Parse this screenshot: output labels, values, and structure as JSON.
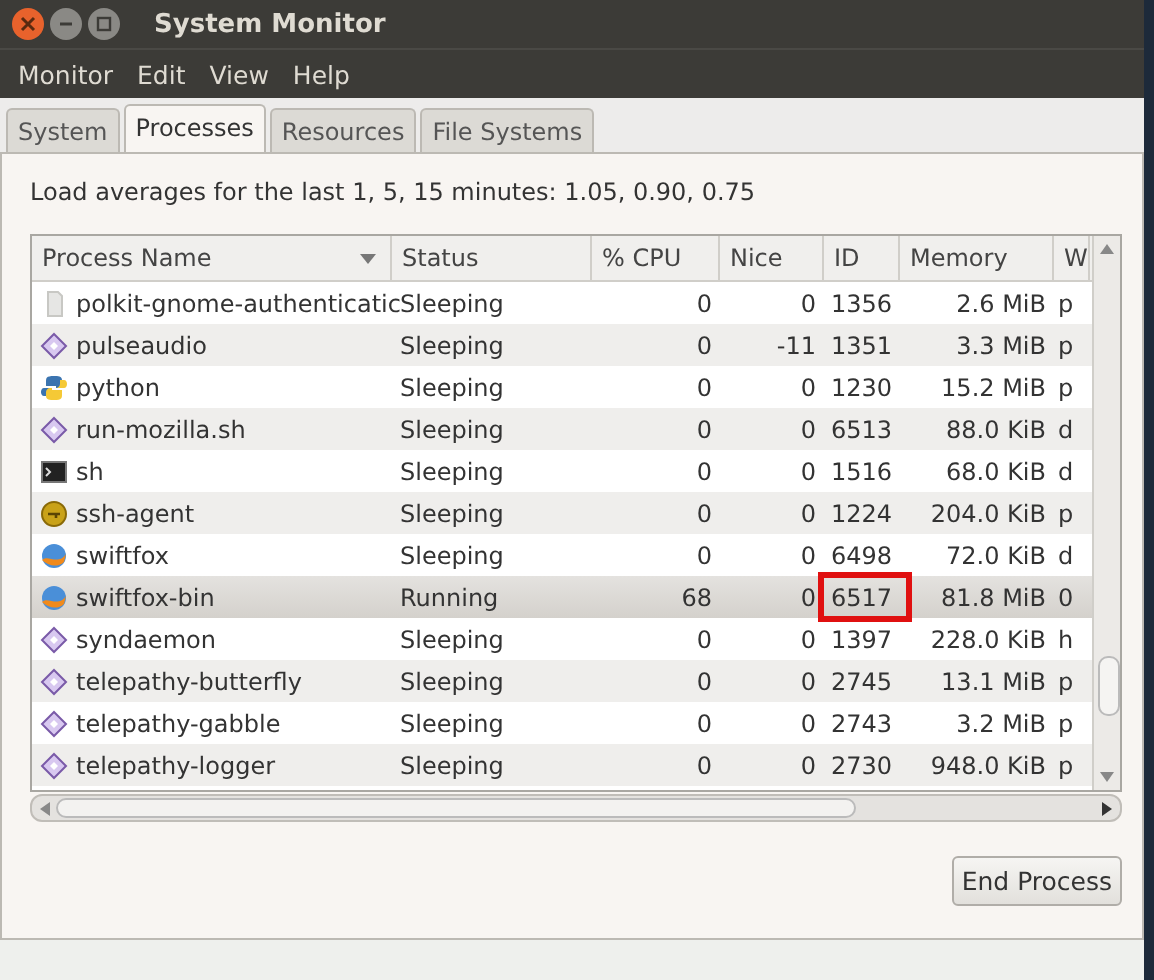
{
  "window": {
    "title": "System Monitor"
  },
  "menu": [
    "Monitor",
    "Edit",
    "View",
    "Help"
  ],
  "tabs": [
    {
      "label": "System",
      "selected": false
    },
    {
      "label": "Processes",
      "selected": true
    },
    {
      "label": "Resources",
      "selected": false
    },
    {
      "label": "File Systems",
      "selected": false
    }
  ],
  "load_averages": "Load averages for the last 1, 5, 15 minutes: 1.05, 0.90, 0.75",
  "table": {
    "columns": [
      "Process Name",
      "Status",
      "% CPU",
      "Nice",
      "ID",
      "Memory",
      "W"
    ],
    "rows": [
      {
        "kind": "blank",
        "name": "polkit-gnome-authenticatic",
        "status": "Sleeping",
        "cpu": "0",
        "nice": "0",
        "id": "1356",
        "memory": "2.6 MiB",
        "column_7": "p",
        "selected": false,
        "id_highlighted": false
      },
      {
        "kind": "diamond",
        "name": "pulseaudio",
        "status": "Sleeping",
        "cpu": "0",
        "nice": "-11",
        "id": "1351",
        "memory": "3.3 MiB",
        "column_7": "p",
        "selected": false,
        "id_highlighted": false
      },
      {
        "kind": "python",
        "name": "python",
        "status": "Sleeping",
        "cpu": "0",
        "nice": "0",
        "id": "1230",
        "memory": "15.2 MiB",
        "column_7": "p",
        "selected": false,
        "id_highlighted": false
      },
      {
        "kind": "diamond",
        "name": "run-mozilla.sh",
        "status": "Sleeping",
        "cpu": "0",
        "nice": "0",
        "id": "6513",
        "memory": "88.0 KiB",
        "column_7": "d",
        "selected": false,
        "id_highlighted": false
      },
      {
        "kind": "terminal",
        "name": "sh",
        "status": "Sleeping",
        "cpu": "0",
        "nice": "0",
        "id": "1516",
        "memory": "68.0 KiB",
        "column_7": "d",
        "selected": false,
        "id_highlighted": false
      },
      {
        "kind": "key",
        "name": "ssh-agent",
        "status": "Sleeping",
        "cpu": "0",
        "nice": "0",
        "id": "1224",
        "memory": "204.0 KiB",
        "column_7": "p",
        "selected": false,
        "id_highlighted": false
      },
      {
        "kind": "globe",
        "name": "swiftfox",
        "status": "Sleeping",
        "cpu": "0",
        "nice": "0",
        "id": "6498",
        "memory": "72.0 KiB",
        "column_7": "d",
        "selected": false,
        "id_highlighted": false
      },
      {
        "kind": "globe",
        "name": "swiftfox-bin",
        "status": "Running",
        "cpu": "68",
        "nice": "0",
        "id": "6517",
        "memory": "81.8 MiB",
        "column_7": "0",
        "selected": true,
        "id_highlighted": true
      },
      {
        "kind": "diamond",
        "name": "syndaemon",
        "status": "Sleeping",
        "cpu": "0",
        "nice": "0",
        "id": "1397",
        "memory": "228.0 KiB",
        "column_7": "h",
        "selected": false,
        "id_highlighted": false
      },
      {
        "kind": "diamond",
        "name": "telepathy-butterfly",
        "status": "Sleeping",
        "cpu": "0",
        "nice": "0",
        "id": "2745",
        "memory": "13.1 MiB",
        "column_7": "p",
        "selected": false,
        "id_highlighted": false
      },
      {
        "kind": "diamond",
        "name": "telepathy-gabble",
        "status": "Sleeping",
        "cpu": "0",
        "nice": "0",
        "id": "2743",
        "memory": "3.2 MiB",
        "column_7": "p",
        "selected": false,
        "id_highlighted": false
      },
      {
        "kind": "diamond",
        "name": "telepathy-logger",
        "status": "Sleeping",
        "cpu": "0",
        "nice": "0",
        "id": "2730",
        "memory": "948.0 KiB",
        "column_7": "p",
        "selected": false,
        "id_highlighted": false
      }
    ]
  },
  "buttons": [
    "End Process"
  ]
}
